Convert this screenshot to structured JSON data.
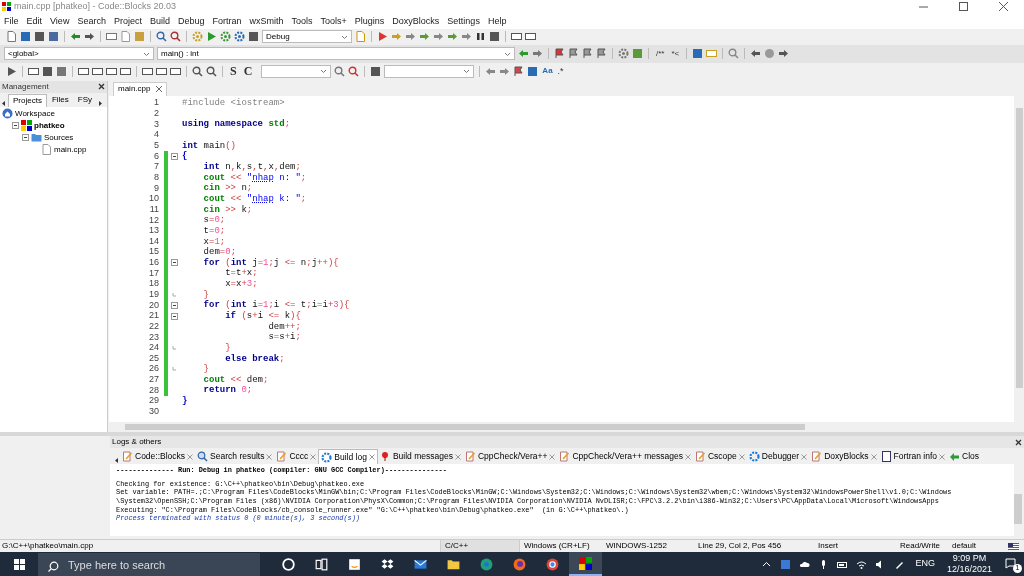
{
  "window": {
    "title": "main.cpp [phatkeo] - Code::Blocks 20.03"
  },
  "menu": [
    "File",
    "Edit",
    "View",
    "Search",
    "Project",
    "Build",
    "Debug",
    "Fortran",
    "wxSmith",
    "Tools",
    "Tools+",
    "Plugins",
    "DoxyBlocks",
    "Settings",
    "Help"
  ],
  "toolbar": {
    "build_target": "Debug",
    "scope": "<global>",
    "function": "main() : int",
    "doxy_labels": [
      "/**",
      "*<"
    ],
    "format_labels": [
      "S",
      "C"
    ],
    "search_option_labels": [
      "Aa",
      ".*"
    ]
  },
  "management": {
    "title": "Management",
    "tabs": [
      {
        "label": "Projects",
        "selected": true
      },
      {
        "label": "Files",
        "selected": false
      },
      {
        "label": "FSy",
        "selected": false
      }
    ],
    "tree": [
      {
        "label": "Workspace",
        "kind": "workspace",
        "expanded": true,
        "children": [
          {
            "label": "phatkeo",
            "kind": "project",
            "expanded": true,
            "children": [
              {
                "label": "Sources",
                "kind": "folder",
                "expanded": true,
                "children": [
                  {
                    "label": "main.cpp",
                    "kind": "file"
                  }
                ]
              }
            ]
          }
        ]
      }
    ]
  },
  "editor": {
    "tab": "main.cpp",
    "lines": [
      {
        "no": "1",
        "changed": false,
        "segments": [
          {
            "kind": "pre",
            "text": "#include <iostream>"
          }
        ]
      },
      {
        "no": "2",
        "changed": false
      },
      {
        "no": "3",
        "changed": false,
        "segments": [
          {
            "kind": "kw",
            "text": "using namespace "
          },
          {
            "kind": "id",
            "text": "std"
          },
          {
            "kind": "op",
            "text": ";"
          }
        ]
      },
      {
        "no": "4",
        "changed": false
      },
      {
        "no": "5",
        "changed": false,
        "segments": [
          {
            "kind": "kw",
            "text": "int"
          },
          {
            "kind": "p",
            "text": " main"
          },
          {
            "kind": "op",
            "text": "()"
          }
        ]
      },
      {
        "no": "6",
        "changed": true,
        "kind": "fold_start",
        "segments": [
          {
            "kind": "brace",
            "text": "{"
          }
        ]
      },
      {
        "no": "7",
        "changed": true,
        "segments": [
          {
            "kind": "kw",
            "text": "    int"
          },
          {
            "kind": "p",
            "text": " n"
          },
          {
            "kind": "op",
            "text": ","
          },
          {
            "kind": "p",
            "text": "k"
          },
          {
            "kind": "op",
            "text": ","
          },
          {
            "kind": "p",
            "text": "s"
          },
          {
            "kind": "op",
            "text": ","
          },
          {
            "kind": "p",
            "text": "t"
          },
          {
            "kind": "op",
            "text": ","
          },
          {
            "kind": "p",
            "text": "x"
          },
          {
            "kind": "op",
            "text": ","
          },
          {
            "kind": "p",
            "text": "dem"
          },
          {
            "kind": "op",
            "text": ";"
          }
        ]
      },
      {
        "no": "8",
        "changed": true,
        "segments": [
          {
            "kind": "id",
            "text": "    cout"
          },
          {
            "kind": "op",
            "text": " << "
          },
          {
            "kind": "str",
            "text": "\""
          },
          {
            "kind": "bad",
            "text": "nhap"
          },
          {
            "kind": "str",
            "text": " n: \""
          },
          {
            "kind": "op",
            "text": ";"
          }
        ]
      },
      {
        "no": "9",
        "changed": true,
        "segments": [
          {
            "kind": "id",
            "text": "    cin"
          },
          {
            "kind": "op",
            "text": " >>"
          },
          {
            "kind": "p",
            "text": " n"
          },
          {
            "kind": "op",
            "text": ";"
          }
        ]
      },
      {
        "no": "10",
        "changed": true,
        "segments": [
          {
            "kind": "id",
            "text": "    cout"
          },
          {
            "kind": "op",
            "text": " << "
          },
          {
            "kind": "str",
            "text": "\""
          },
          {
            "kind": "bad",
            "text": "nhap"
          },
          {
            "kind": "str",
            "text": " k: \""
          },
          {
            "kind": "op",
            "text": ";"
          }
        ]
      },
      {
        "no": "11",
        "changed": true,
        "segments": [
          {
            "kind": "id",
            "text": "    cin"
          },
          {
            "kind": "op",
            "text": " >>"
          },
          {
            "kind": "p",
            "text": " k"
          },
          {
            "kind": "op",
            "text": ";"
          }
        ]
      },
      {
        "no": "12",
        "changed": true,
        "segments": [
          {
            "kind": "p",
            "text": "    s"
          },
          {
            "kind": "op",
            "text": "="
          },
          {
            "kind": "num",
            "text": "0"
          },
          {
            "kind": "op",
            "text": ";"
          }
        ]
      },
      {
        "no": "13",
        "changed": true,
        "segments": [
          {
            "kind": "p",
            "text": "    t"
          },
          {
            "kind": "op",
            "text": "="
          },
          {
            "kind": "num",
            "text": "0"
          },
          {
            "kind": "op",
            "text": ";"
          }
        ]
      },
      {
        "no": "14",
        "changed": true,
        "segments": [
          {
            "kind": "p",
            "text": "    x"
          },
          {
            "kind": "op",
            "text": "="
          },
          {
            "kind": "num",
            "text": "1"
          },
          {
            "kind": "op",
            "text": ";"
          }
        ]
      },
      {
        "no": "15",
        "changed": true,
        "segments": [
          {
            "kind": "p",
            "text": "    dem"
          },
          {
            "kind": "op",
            "text": "="
          },
          {
            "kind": "num",
            "text": "0"
          },
          {
            "kind": "op",
            "text": ";"
          }
        ]
      },
      {
        "no": "16",
        "changed": true,
        "kind": "fold_start",
        "segments": [
          {
            "kind": "kw",
            "text": "    for"
          },
          {
            "kind": "op",
            "text": " ("
          },
          {
            "kind": "kw",
            "text": "int"
          },
          {
            "kind": "p",
            "text": " j"
          },
          {
            "kind": "op",
            "text": "="
          },
          {
            "kind": "num",
            "text": "1"
          },
          {
            "kind": "op",
            "text": ";"
          },
          {
            "kind": "p",
            "text": "j"
          },
          {
            "kind": "op",
            "text": " <="
          },
          {
            "kind": "p",
            "text": " n"
          },
          {
            "kind": "op",
            "text": ";"
          },
          {
            "kind": "p",
            "text": "j"
          },
          {
            "kind": "op",
            "text": "++){"
          }
        ]
      },
      {
        "no": "17",
        "changed": true,
        "segments": [
          {
            "kind": "p",
            "text": "        t"
          },
          {
            "kind": "op",
            "text": "="
          },
          {
            "kind": "p",
            "text": "t"
          },
          {
            "kind": "op",
            "text": "+"
          },
          {
            "kind": "p",
            "text": "x"
          },
          {
            "kind": "op",
            "text": ";"
          }
        ]
      },
      {
        "no": "18",
        "changed": true,
        "segments": [
          {
            "kind": "p",
            "text": "        x"
          },
          {
            "kind": "op",
            "text": "="
          },
          {
            "kind": "p",
            "text": "x"
          },
          {
            "kind": "op",
            "text": "+"
          },
          {
            "kind": "num",
            "text": "3"
          },
          {
            "kind": "op",
            "text": ";"
          }
        ]
      },
      {
        "no": "19",
        "changed": true,
        "kind": "fold_end",
        "segments": [
          {
            "kind": "op",
            "text": "    }"
          }
        ]
      },
      {
        "no": "20",
        "changed": true,
        "kind": "fold_start",
        "segments": [
          {
            "kind": "kw",
            "text": "    for"
          },
          {
            "kind": "op",
            "text": " ("
          },
          {
            "kind": "kw",
            "text": "int"
          },
          {
            "kind": "p",
            "text": " i"
          },
          {
            "kind": "op",
            "text": "="
          },
          {
            "kind": "num",
            "text": "1"
          },
          {
            "kind": "op",
            "text": ";"
          },
          {
            "kind": "p",
            "text": "i"
          },
          {
            "kind": "op",
            "text": " <="
          },
          {
            "kind": "p",
            "text": " t"
          },
          {
            "kind": "op",
            "text": ";"
          },
          {
            "kind": "p",
            "text": "i"
          },
          {
            "kind": "op",
            "text": "="
          },
          {
            "kind": "p",
            "text": "i"
          },
          {
            "kind": "op",
            "text": "+"
          },
          {
            "kind": "num",
            "text": "3"
          },
          {
            "kind": "op",
            "text": "){"
          }
        ]
      },
      {
        "no": "21",
        "changed": true,
        "kind": "fold_start",
        "segments": [
          {
            "kind": "kw",
            "text": "        if"
          },
          {
            "kind": "op",
            "text": " ("
          },
          {
            "kind": "p",
            "text": "s"
          },
          {
            "kind": "op",
            "text": "+"
          },
          {
            "kind": "p",
            "text": "i"
          },
          {
            "kind": "op",
            "text": " <="
          },
          {
            "kind": "p",
            "text": " k"
          },
          {
            "kind": "op",
            "text": "){"
          }
        ]
      },
      {
        "no": "22",
        "changed": true,
        "segments": [
          {
            "kind": "p",
            "text": "                dem"
          },
          {
            "kind": "op",
            "text": "++;"
          }
        ]
      },
      {
        "no": "23",
        "changed": true,
        "segments": [
          {
            "kind": "p",
            "text": "                s"
          },
          {
            "kind": "op",
            "text": "="
          },
          {
            "kind": "p",
            "text": "s"
          },
          {
            "kind": "op",
            "text": "+"
          },
          {
            "kind": "p",
            "text": "i"
          },
          {
            "kind": "op",
            "text": ";"
          }
        ]
      },
      {
        "no": "24",
        "changed": true,
        "kind": "fold_end",
        "segments": [
          {
            "kind": "op",
            "text": "        }"
          }
        ]
      },
      {
        "no": "25",
        "changed": true,
        "segments": [
          {
            "kind": "kw",
            "text": "        else break"
          },
          {
            "kind": "op",
            "text": ";"
          }
        ]
      },
      {
        "no": "26",
        "changed": true,
        "kind": "fold_end",
        "segments": [
          {
            "kind": "op",
            "text": "    }"
          }
        ]
      },
      {
        "no": "27",
        "changed": true,
        "segments": [
          {
            "kind": "id",
            "text": "    cout"
          },
          {
            "kind": "op",
            "text": " <<"
          },
          {
            "kind": "p",
            "text": " dem"
          },
          {
            "kind": "op",
            "text": ";"
          }
        ]
      },
      {
        "no": "28",
        "changed": true,
        "segments": [
          {
            "kind": "kw",
            "text": "    return"
          },
          {
            "kind": "num",
            "text": " 0"
          },
          {
            "kind": "op",
            "text": ";"
          }
        ]
      },
      {
        "no": "29",
        "changed": false,
        "segments": [
          {
            "kind": "brace",
            "text": "}"
          }
        ]
      },
      {
        "no": "30",
        "changed": false
      }
    ]
  },
  "logs": {
    "title": "Logs & others",
    "tabs": [
      {
        "label": "Code::Blocks",
        "kind": "note",
        "selected": false
      },
      {
        "label": "Search results",
        "kind": "search",
        "selected": false
      },
      {
        "label": "Cccc",
        "kind": "note",
        "selected": false
      },
      {
        "label": "Build log",
        "kind": "gear",
        "selected": true
      },
      {
        "label": "Build messages",
        "kind": "pin",
        "selected": false
      },
      {
        "label": "CppCheck/Vera++",
        "kind": "note",
        "selected": false
      },
      {
        "label": "CppCheck/Vera++ messages",
        "kind": "note",
        "selected": false
      },
      {
        "label": "Cscope",
        "kind": "note",
        "selected": false
      },
      {
        "label": "Debugger",
        "kind": "gear",
        "selected": false
      },
      {
        "label": "DoxyBlocks",
        "kind": "note",
        "selected": false
      },
      {
        "label": "Fortran info",
        "kind": "doc",
        "selected": false
      },
      {
        "label": "Clos",
        "kind": "arrow",
        "selected": false
      }
    ],
    "lines": [
      {
        "kind": "header",
        "text": "-------------- Run: Debug in phatkeo (compiler: GNU GCC Compiler)---------------"
      },
      {
        "kind": "plain",
        "text": "Checking for existence: G:\\C++\\phatkeo\\bin\\Debug\\phatkeo.exe"
      },
      {
        "kind": "plain",
        "text": "Set variable: PATH=.;C:\\Program Files\\CodeBlocks\\MinGW\\bin;C:\\Program Files\\CodeBlocks\\MinGW;C:\\Windows\\System32;C:\\Windows;C:\\Windows\\System32\\wbem;C:\\Windows\\System32\\WindowsPowerShell\\v1.0;C:\\Windows"
      },
      {
        "kind": "plain",
        "text": "\\System32\\OpenSSH;C:\\Program Files (x86)\\NVIDIA Corporation\\PhysX\\Common;C:\\Program Files\\NVIDIA Corporation\\NVIDIA NvDLISR;C:\\FPC\\3.2.2\\bin\\i386-Win32;C:\\Users\\PC\\AppData\\Local\\Microsoft\\WindowsApps"
      },
      {
        "kind": "plain",
        "text": "Executing: \"C:\\Program Files\\CodeBlocks/cb_console_runner.exe\" \"G:\\C++\\phatkeo\\bin\\Debug\\phatkeo.exe\"  (in G:\\C++\\phatkeo\\.)"
      },
      {
        "kind": "status",
        "text": "Process terminated with status 0 (0 minute(s), 3 second(s))"
      }
    ]
  },
  "status_bar": {
    "path": "G:\\C++\\phatkeo\\main.cpp",
    "language": "C/C++",
    "line_endings": "Windows (CR+LF)",
    "encoding": "WINDOWS-1252",
    "position": "Line 29, Col 2, Pos 456",
    "mode": "Insert",
    "access": "Read/Write",
    "profile": "default"
  },
  "taskbar": {
    "search_placeholder": "Type here to search",
    "language": "ENG",
    "time": "9:09 PM",
    "date": "12/16/2021",
    "notifications": "1"
  }
}
